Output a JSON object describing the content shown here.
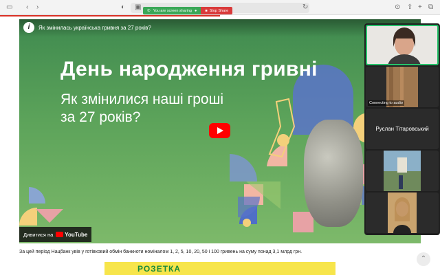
{
  "browser": {
    "share_status": "You are screen sharing",
    "stop_share_label": "Stop Share"
  },
  "video": {
    "title": "Як змінилась українська гривня за 27 років?",
    "channel_icon_letter": "i",
    "headline": "День народження гривні",
    "subline": "Як змінилися наші гроші за 27 років?",
    "watch_on": "Дивитися на",
    "youtube_label": "YouTube"
  },
  "article": {
    "caption": "За цей період Нацбанк увів у готівковий обмін банкноти номіналом 1, 2, 5, 10, 20, 50 і 100 гривень на суму понад 3,1 млрд грн."
  },
  "banner": {
    "text": "РОЗЕТКА"
  },
  "participants": {
    "connecting_label": "Connecting to audio",
    "name_tile": "Руслан Тітаровський"
  },
  "colors": {
    "video_green": "#5ca35a",
    "youtube_red": "#ff0000",
    "share_green": "#3aa757",
    "share_red": "#d93a3a",
    "active_speaker_border": "#26c26a"
  },
  "icons": [
    "sidebar-icon",
    "back-icon",
    "forward-icon",
    "shield-icon",
    "tab-icon",
    "reload-icon",
    "download-icon",
    "share-icon",
    "add-tab-icon",
    "tabs-icon",
    "play-icon",
    "scroll-top-icon"
  ]
}
